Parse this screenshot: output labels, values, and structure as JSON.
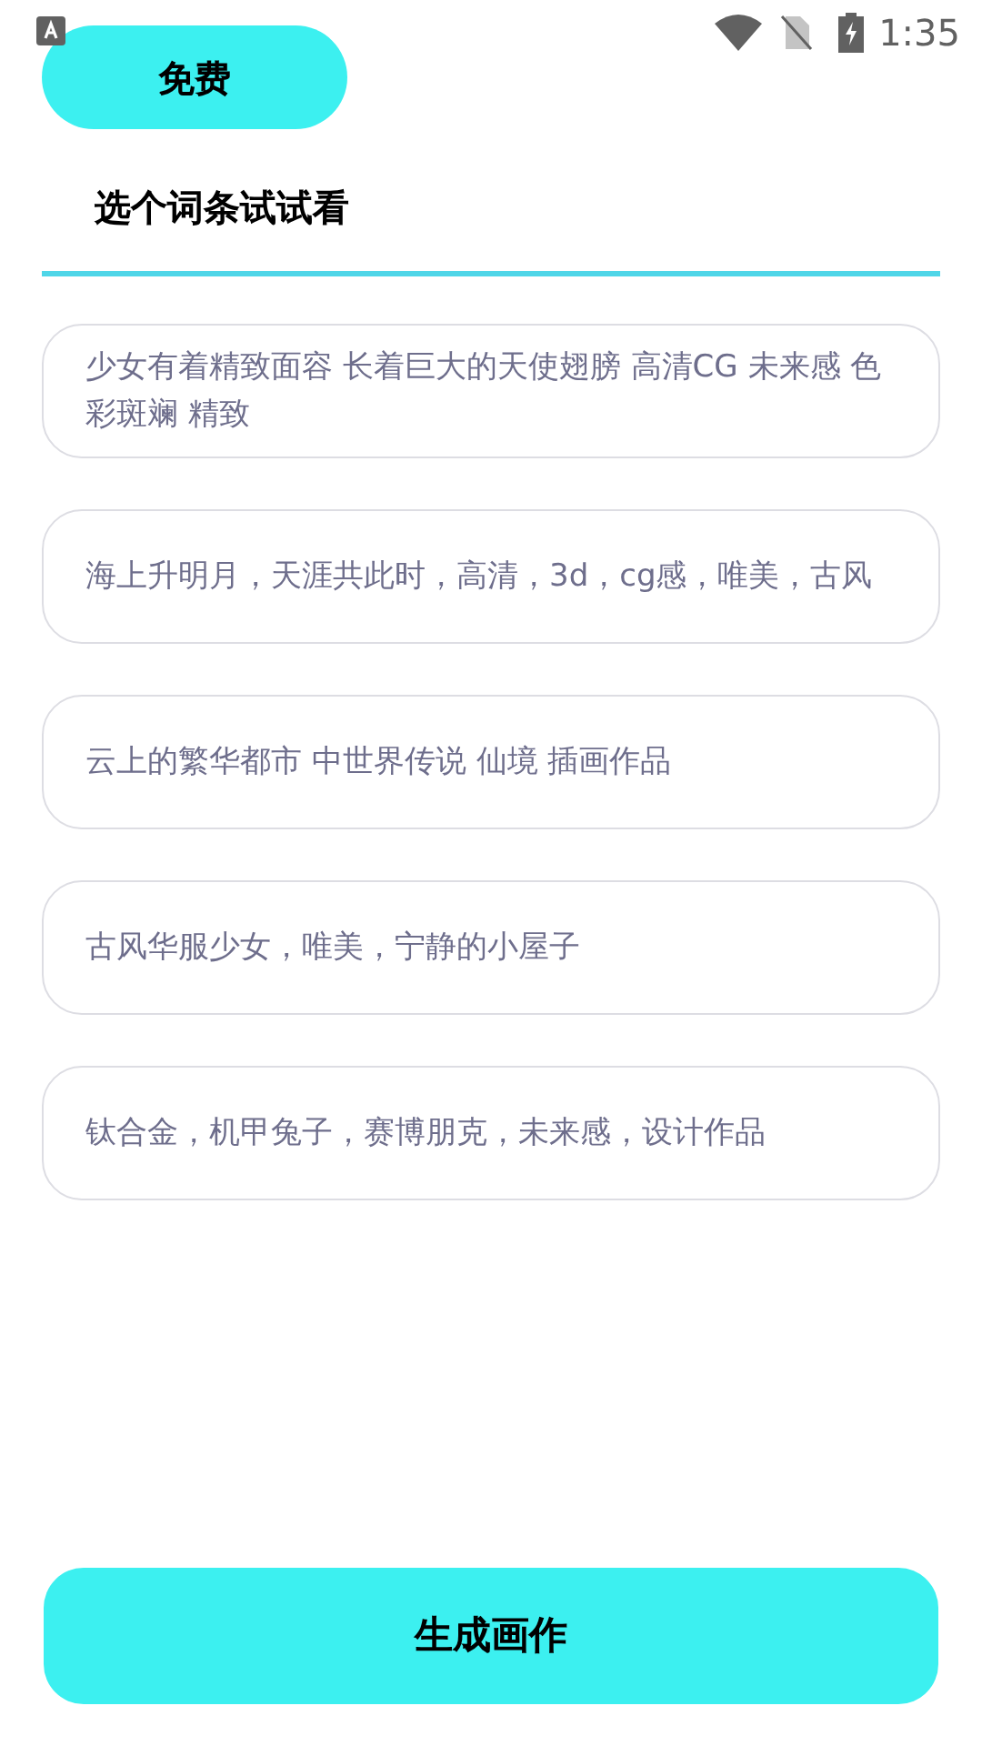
{
  "status_bar": {
    "time": "1:35"
  },
  "free_button": {
    "label": "免费"
  },
  "heading": "选个词条试试看",
  "prompts": [
    {
      "text": "少女有着精致面容 长着巨大的天使翅膀 高清CG 未来感 色彩斑斓 精致"
    },
    {
      "text": "海上升明月，天涯共此时，高清，3d，cg感，唯美，古风"
    },
    {
      "text": "云上的繁华都市 中世界传说 仙境 插画作品"
    },
    {
      "text": "古风华服少女，唯美，宁静的小屋子"
    },
    {
      "text": "钛合金，机甲兔子，赛博朋克，未来感，设计作品"
    }
  ],
  "generate_button": {
    "label": "生成画作"
  }
}
